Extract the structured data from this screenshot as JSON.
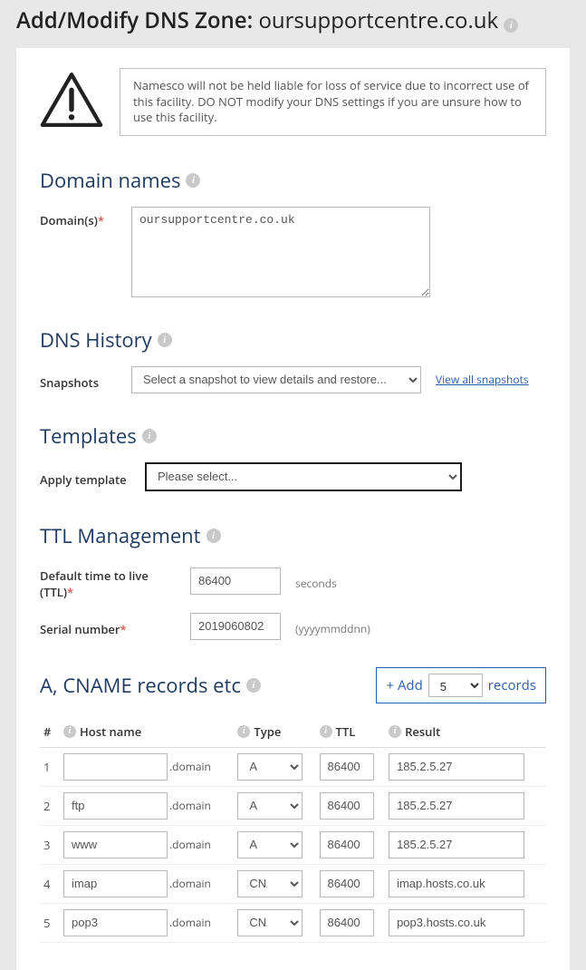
{
  "title_prefix": "Add/Modify DNS Zone: ",
  "title_domain": "oursupportcentre.co.uk",
  "warning_text": "Namesco will not be held liable for loss of service due to incorrect use of this facility. DO NOT modify your DNS settings if you are unsure how to use this facility.",
  "sections": {
    "domain_names": "Domain names",
    "dns_history": "DNS History",
    "templates": "Templates",
    "ttl": "TTL Management",
    "records": "A, CNAME records etc"
  },
  "labels": {
    "domains": "Domain(s)",
    "snapshots": "Snapshots",
    "view_all_snapshots": "View all snapshots",
    "apply_template": "Apply template",
    "default_ttl": "Default time to live (TTL)",
    "serial": "Serial number",
    "seconds": "seconds",
    "yyyymmddnn": "(yyyymmddnn)",
    "add_prefix": "+ Add",
    "add_suffix": "records"
  },
  "values": {
    "domains_text": "oursupportcentre.co.uk",
    "snapshot_placeholder": "Select a snapshot to view details and restore...",
    "template_placeholder": "Please select...",
    "default_ttl": "86400",
    "serial": "2019060802",
    "add_count": "5"
  },
  "table": {
    "headers": {
      "num": "#",
      "host": "Host name",
      "type": "Type",
      "ttl": "TTL",
      "result": "Result"
    },
    "domain_suffix": ".domain",
    "rows": [
      {
        "n": "1",
        "host": "",
        "type": "A",
        "ttl": "86400",
        "result": "185.2.5.27"
      },
      {
        "n": "2",
        "host": "ftp",
        "type": "A",
        "ttl": "86400",
        "result": "185.2.5.27"
      },
      {
        "n": "3",
        "host": "www",
        "type": "A",
        "ttl": "86400",
        "result": "185.2.5.27"
      },
      {
        "n": "4",
        "host": "imap",
        "type": "CNAME",
        "ttl": "86400",
        "result": "imap.hosts.co.uk"
      },
      {
        "n": "5",
        "host": "pop3",
        "type": "CNAME",
        "ttl": "86400",
        "result": "pop3.hosts.co.uk"
      }
    ]
  }
}
